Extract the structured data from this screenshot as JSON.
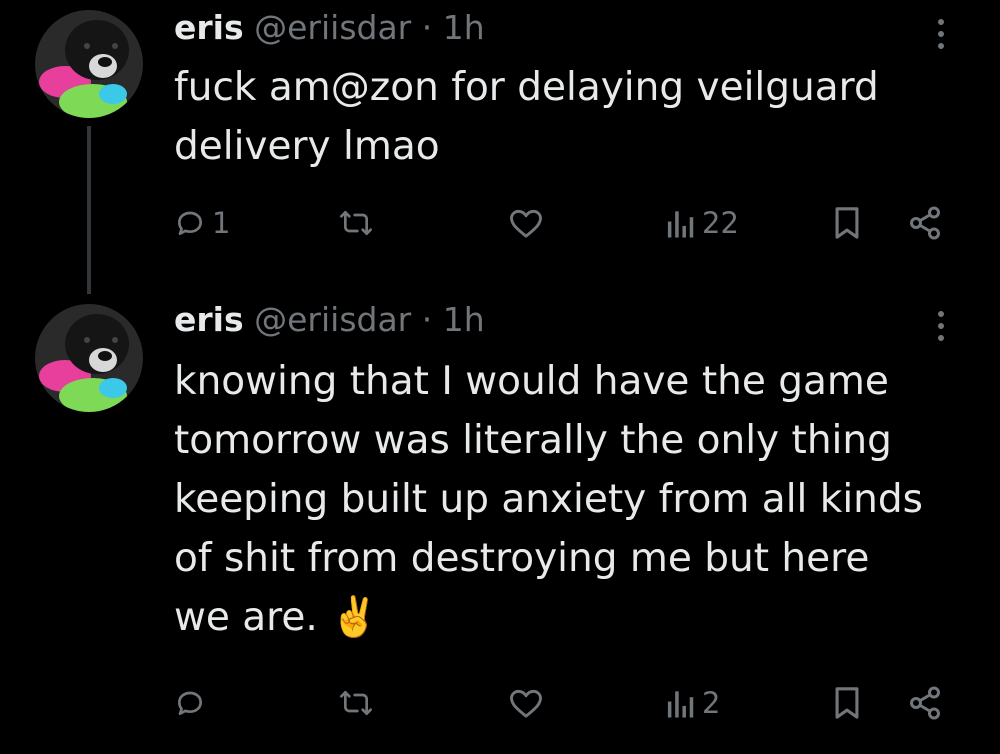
{
  "tweets": [
    {
      "name": "eris",
      "handle": "@eriisdar",
      "separator": "·",
      "time": "1h",
      "text": "fuck am@zon for delaying veilguard\ndelivery lmao",
      "reply_count": "1",
      "retweet_count": "",
      "like_count": "",
      "views_count": "22"
    },
    {
      "name": "eris",
      "handle": "@eriisdar",
      "separator": "·",
      "time": "1h",
      "text": "knowing that I would have the game\ntomorrow was literally the only thing\nkeeping built up anxiety from all kinds\nof shit from destroying me but here\nwe are. ✌️",
      "reply_count": "",
      "retweet_count": "",
      "like_count": "",
      "views_count": "2"
    }
  ],
  "icons": {
    "reply": "reply-icon",
    "retweet": "retweet-icon",
    "like": "heart-icon",
    "views": "views-icon",
    "bookmark": "bookmark-icon",
    "share": "share-icon",
    "more": "more-icon"
  },
  "colors": {
    "background": "#000000",
    "primary_text": "#e7e9ea",
    "secondary_text": "#71767b",
    "thread_line": "#333639"
  }
}
